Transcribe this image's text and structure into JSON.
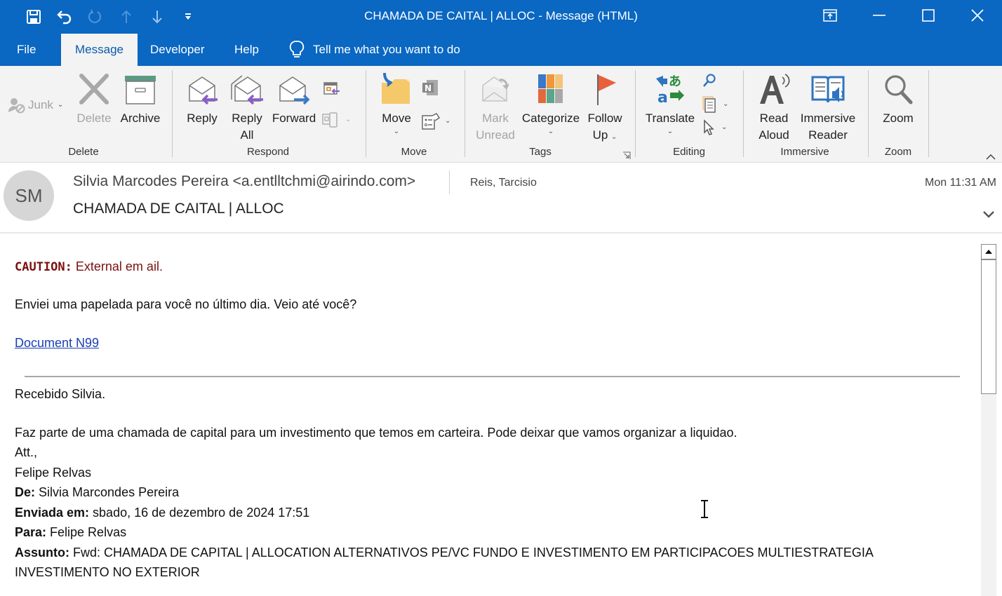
{
  "window": {
    "title": "CHAMADA DE CAITAL | ALLOC  -  Message (HTML)",
    "quick_access": [
      "save-icon",
      "undo-icon",
      "redo-icon",
      "previous-item-icon",
      "next-item-icon",
      "customize-qat-icon"
    ],
    "controls": [
      "ribbon-display-options-icon",
      "minimize-icon",
      "maximize-icon",
      "close-icon"
    ]
  },
  "tabs": {
    "file": "File",
    "message": "Message",
    "developer": "Developer",
    "help": "Help",
    "tell_me": "Tell me what you want to do",
    "active": "Message"
  },
  "ribbon": {
    "delete": {
      "group": "Delete",
      "junk": "Junk",
      "delete": "Delete",
      "archive": "Archive"
    },
    "respond": {
      "group": "Respond",
      "reply": "Reply",
      "reply_all_1": "Reply",
      "reply_all_2": "All",
      "forward": "Forward"
    },
    "move": {
      "group": "Move",
      "move": "Move"
    },
    "tags": {
      "group": "Tags",
      "mark_unread_1": "Mark",
      "mark_unread_2": "Unread",
      "categorize": "Categorize",
      "follow_up_1": "Follow",
      "follow_up_2": "Up"
    },
    "editing": {
      "group": "Editing",
      "translate": "Translate"
    },
    "immersive": {
      "group": "Immersive",
      "read_aloud_1": "Read",
      "read_aloud_2": "Aloud",
      "immersive_reader_1": "Immersive",
      "immersive_reader_2": "Reader"
    },
    "zoom": {
      "group": "Zoom",
      "zoom": "Zoom"
    }
  },
  "message": {
    "avatar_initials": "SM",
    "from": "Silvia Marcodes Pereira <a.entlltchmi@airindo.com>",
    "to": "Reis, Tarcisio",
    "time": "Mon 11:31 AM",
    "subject": "CHAMADA DE CAITAL | ALLOC"
  },
  "body": {
    "caution_label": "CAUTION:",
    "caution_text": " External em ail.",
    "line1": "Enviei uma papelada para você no último dia.  Veio até você?",
    "link": "Document N99",
    "reply_greeting": "Recebido Silvia.",
    "reply_text": "Faz parte de uma chamada de capital para um investimento que temos em carteira. Pode deixar que vamos organizar  a liquidao.",
    "signoff": "Att.,",
    "signature": "Felipe Relvas",
    "fwd": {
      "de_label": "De:",
      "de_value": " Silvia Marcondes Pereira",
      "enviada_label": "Enviada em:",
      "enviada_value": " sbado, 16 de dezembro de 2024 17:51",
      "para_label": "Para:",
      "para_value": " Felipe Relvas",
      "assunto_label": "Assunto:",
      "assunto_value": " Fwd: CHAMADA DE CAPITAL | ALLOCATION ALTERNATIVOS PE/VC FUNDO E INVESTIMENTO EM PARTICIPACOES MULTIESTRATEGIA",
      "assunto_cont": "INVESTIMENTO NO EXTERIOR"
    }
  },
  "colors": {
    "title_bar": "#0a67c2",
    "ribbon_bg": "#f3f3f3",
    "caution": "#7a1010",
    "link": "#1a3fb4"
  }
}
